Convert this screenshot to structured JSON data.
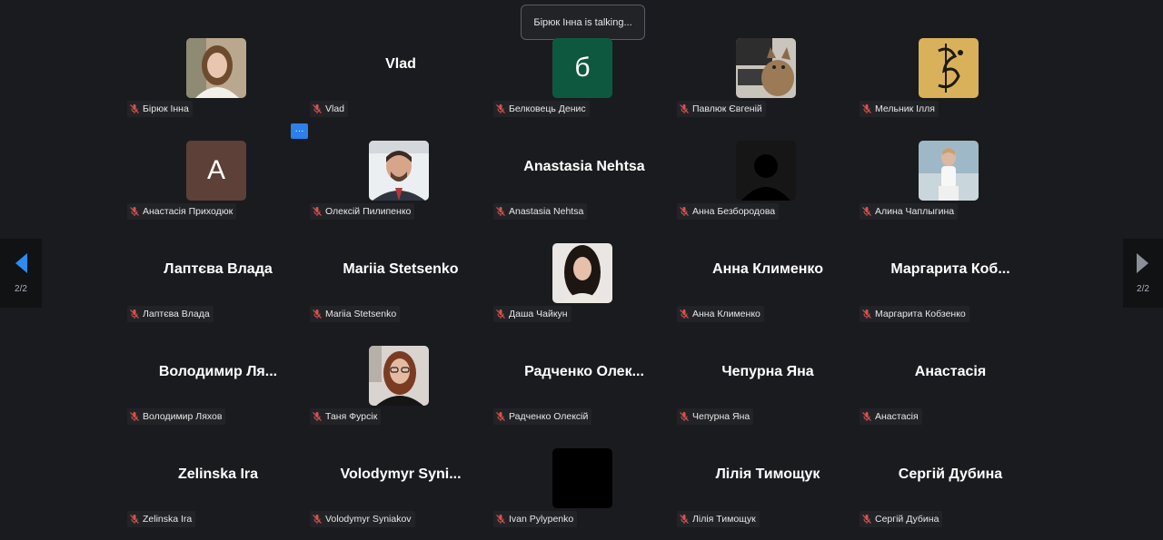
{
  "talking_banner": "Бірюк Інна is talking...",
  "colors": {
    "background": "#1a1b1f",
    "accent_blue": "#2d7fea",
    "mic_muted": "#d9534f"
  },
  "more_button_label": "···",
  "nav": {
    "prev_page": "2/2",
    "next_page": "2/2",
    "prev_icon": "chevron-left-icon",
    "next_icon": "chevron-right-icon"
  },
  "participants": [
    {
      "big": "",
      "label": "Бірюк Інна",
      "avatar": "photo-girl-blonde"
    },
    {
      "big": "Vlad",
      "label": "Vlad",
      "avatar": ""
    },
    {
      "big": "",
      "label": "Белковець Денис",
      "avatar": "letter",
      "letter": "б",
      "bg": "#0f5840"
    },
    {
      "big": "",
      "label": "Павлюк Євгеній",
      "avatar": "photo-cat"
    },
    {
      "big": "",
      "label": "Мельник Ілля",
      "avatar": "photo-gold-logo"
    },
    {
      "big": "",
      "label": "Анастасія Приходюк",
      "avatar": "letter",
      "letter": "A",
      "bg": "#5d4037"
    },
    {
      "big": "",
      "label": "Олексій Пилипенко",
      "avatar": "photo-man-suit"
    },
    {
      "big": "Anastasia Nehtsa",
      "label": "Anastasia Nehtsa",
      "avatar": ""
    },
    {
      "big": "",
      "label": "Анна Безбородова",
      "avatar": "photo-silhouette"
    },
    {
      "big": "",
      "label": "Алина Чаплыгина",
      "avatar": "photo-girl-sea"
    },
    {
      "big": "Лаптєва Влада",
      "label": "Лаптєва Влада",
      "avatar": ""
    },
    {
      "big": "Mariia Stetsenko",
      "label": "Mariia Stetsenko",
      "avatar": ""
    },
    {
      "big": "",
      "label": "Даша Чайкун",
      "avatar": "photo-girl-dark"
    },
    {
      "big": "Анна Клименко",
      "label": "Анна Клименко",
      "avatar": ""
    },
    {
      "big": "Маргарита Коб...",
      "label": "Маргарита Кобзенко",
      "avatar": ""
    },
    {
      "big": "Володимир Ля...",
      "label": "Володимир Ляхов",
      "avatar": ""
    },
    {
      "big": "",
      "label": "Таня Фурсік",
      "avatar": "photo-girl-glasses"
    },
    {
      "big": "Радченко Олек...",
      "label": "Радченко Олексій",
      "avatar": ""
    },
    {
      "big": "Чепурна Яна",
      "label": "Чепурна Яна",
      "avatar": ""
    },
    {
      "big": "Анастасія",
      "label": "Анастасія",
      "avatar": ""
    },
    {
      "big": "Zelinska Ira",
      "label": "Zelinska Ira",
      "avatar": ""
    },
    {
      "big": "Volodymyr Syni...",
      "label": "Volodymyr Syniakov",
      "avatar": ""
    },
    {
      "big": "",
      "label": "Ivan Pylypenko",
      "avatar": "photo-black"
    },
    {
      "big": "Лілія Тимощук",
      "label": "Лілія Тимощук",
      "avatar": ""
    },
    {
      "big": "Сергій Дубина",
      "label": "Сергій Дубина",
      "avatar": ""
    }
  ]
}
